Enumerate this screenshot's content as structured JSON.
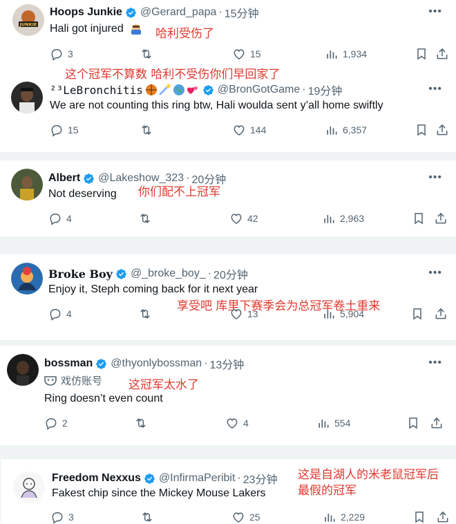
{
  "tweets": [
    {
      "name": "Hoops Junkie",
      "handle": "@Gerard_papa",
      "time": "15分钟",
      "text": "Hali got injured",
      "cn": "哈利受伤了",
      "replies": "3",
      "reposts": "",
      "likes": "15",
      "views": "1,934",
      "avatar_label": "JUNKIE"
    },
    {
      "name": "LeBronchitis",
      "name_prefix": "²³",
      "handle": "@BronGotGame",
      "time": "19分钟",
      "text": "We are not counting this ring btw, Hali woulda sent y’all home swiftly",
      "cn": "这个冠军不算数 哈利不受伤你们早回家了",
      "replies": "15",
      "reposts": "",
      "likes": "144",
      "views": "6,357"
    },
    {
      "name": "Albert",
      "handle": "@Lakeshow_323",
      "time": "20分钟",
      "text": "Not deserving",
      "cn": "你们配不上冠军",
      "replies": "4",
      "reposts": "",
      "likes": "42",
      "views": "2,963"
    },
    {
      "name": "Broke Boy",
      "handle": "@_broke_boy_",
      "time": "20分钟",
      "text": "Enjoy it, Steph coming back for it next year",
      "cn": "享受吧 库里下赛季会为总冠军卷土重来",
      "replies": "4",
      "reposts": "",
      "likes": "13",
      "views": "5,904"
    },
    {
      "name": "bossman",
      "handle": "@thyonlybossman",
      "time": "13分钟",
      "parody": "戏仿账号",
      "text": "Ring doesn’t even count",
      "cn": "这冠军太水了",
      "replies": "2",
      "reposts": "",
      "likes": "4",
      "views": "554"
    },
    {
      "name": "Freedom Nexxus",
      "handle": "@InfirmaPeribit",
      "time": "23分钟",
      "text": "Fakest chip since the Mickey Mouse Lakers",
      "cn_line1": "这是自湖人的米老鼠冠军后",
      "cn_line2": "最假的冠军",
      "replies": "3",
      "reposts": "",
      "likes": "25",
      "views": "2,229"
    }
  ],
  "dot": "·",
  "more": "•••",
  "colors": {
    "verified": "#1d9bf0",
    "annotation": "#e0382e",
    "muted": "#536471"
  }
}
